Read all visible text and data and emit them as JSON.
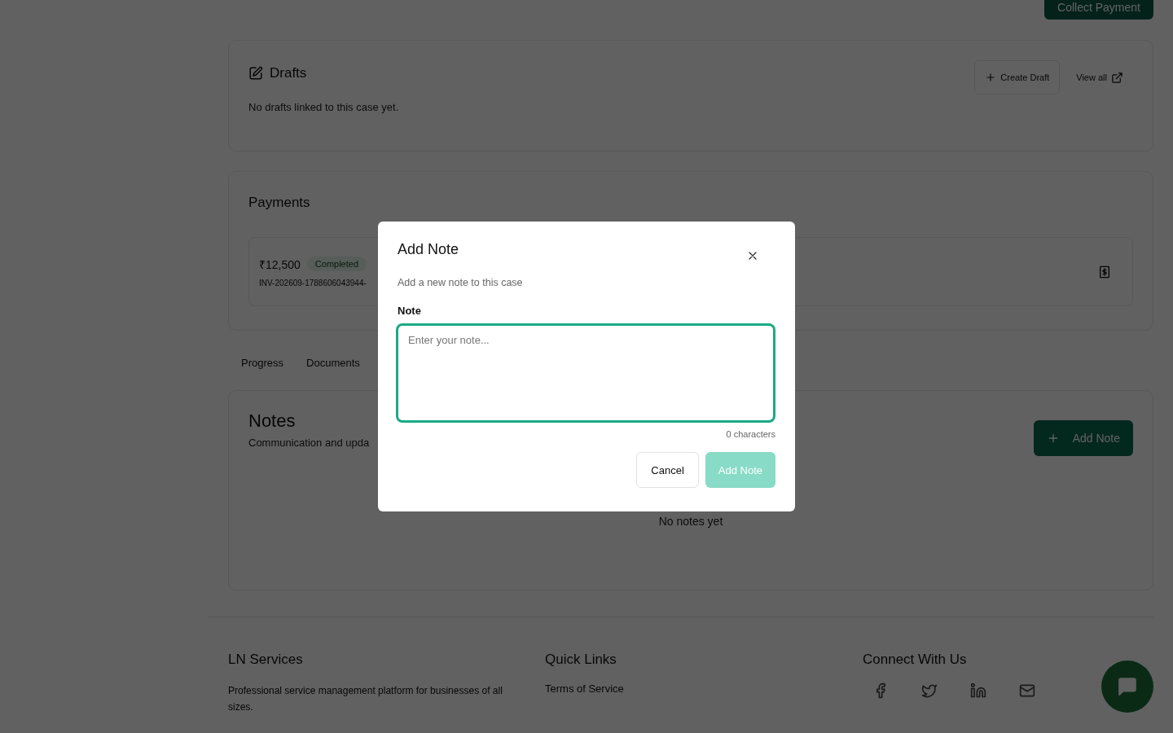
{
  "header": {
    "action_button": "Collect Payment"
  },
  "drafts": {
    "title": "Drafts",
    "empty_text": "No drafts linked to this case yet.",
    "create_button": "Create Draft",
    "view_all_link": "View all"
  },
  "payments": {
    "title": "Payments",
    "items": [
      {
        "amount": "₹12,500",
        "status": "Completed",
        "reference": "INV-202609-1788606043944-"
      }
    ]
  },
  "tabs": [
    {
      "label": "Progress",
      "selected": false
    },
    {
      "label": "Documents",
      "selected": false
    }
  ],
  "notes": {
    "title": "Notes",
    "subtitle": "Communication and upda",
    "add_button": "Add Note",
    "empty_text": "No notes yet"
  },
  "footer": {
    "columns": [
      {
        "title": "LN Services",
        "kind": "text",
        "text": "Professional service management platform for businesses of all sizes."
      },
      {
        "title": "Quick Links",
        "kind": "links",
        "links": [
          "Terms of Service"
        ]
      },
      {
        "title": "Connect With Us",
        "kind": "social"
      }
    ]
  },
  "dialog": {
    "title": "Add Note",
    "description": "Add a new note to this case",
    "field_label": "Note",
    "placeholder": "Enter your note...",
    "counter": "0 characters",
    "cancel_button": "Cancel",
    "submit_button": "Add Note",
    "submit_disabled": true
  }
}
